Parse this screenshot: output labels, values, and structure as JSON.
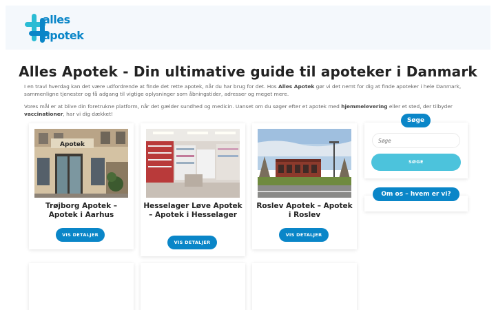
{
  "header": {
    "logo_line1": "alles",
    "logo_line2": "apotek",
    "colors": {
      "brand_blue": "#0a86c8",
      "brand_teal": "#2bbcd4"
    }
  },
  "main": {
    "title": "Alles Apotek - Din ultimative guide til apoteker i Danmark",
    "intro1_a": "I en travl hverdag kan det være udfordrende at finde det rette apotek, når du har brug for det. Hos ",
    "intro1_b": "Alles Apotek",
    "intro1_c": " gør vi det nemt for dig at finde apoteker i hele Danmark, sammenligne tjenester og få adgang til vigtige oplysninger som åbningstider, adresser og meget mere.",
    "intro2_a": "Vores mål er at blive din foretrukne platform, når det gælder sundhed og medicin. Uanset om du søger efter et apotek med ",
    "intro2_b": "hjemmelevering",
    "intro2_c": " eller et sted, der tilbyder ",
    "intro2_d": "vaccinationer",
    "intro2_e": ", har vi dig dækket!"
  },
  "cards": [
    {
      "name": "Trøjborg Apotek – Apotek i Aarhus",
      "button": "VIS DETALJER"
    },
    {
      "name": "Hesselager Løve Apotek – Apotek i Hesselager",
      "button": "VIS DETALJER"
    },
    {
      "name": "Roslev Apotek – Apotek i Roslev",
      "button": "VIS DETALJER"
    }
  ],
  "sidebar": {
    "search_title": "Søge",
    "search_placeholder": "Søge",
    "search_button": "SØGE",
    "about_title": "Om os – hvem er vi?"
  },
  "photo_labels": {
    "store_sign": "Apotek"
  }
}
